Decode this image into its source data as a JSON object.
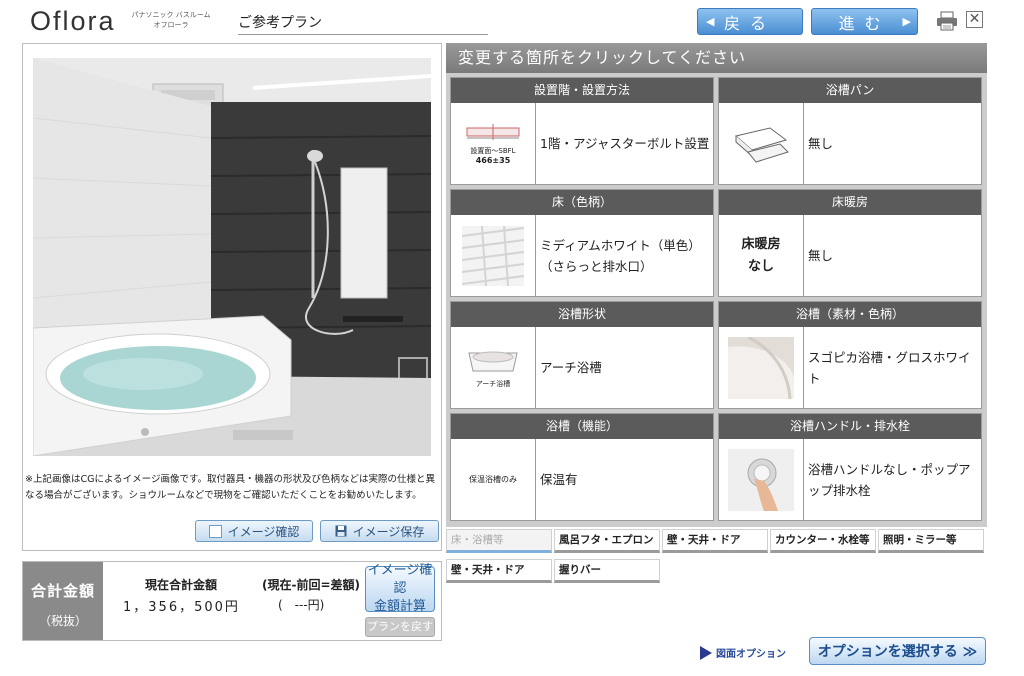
{
  "header": {
    "logo": "Oflora",
    "brand_line1": "パナソニック バスルーム",
    "brand_line2": "オフローラ",
    "plan_name": "ご参考プラン",
    "back_label": "戻る",
    "forward_label": "進む",
    "back_icon": "triangle-left-icon",
    "forward_icon": "triangle-right-icon",
    "close_glyph": "✕"
  },
  "preview": {
    "disclaimer": "※上記画像はCGによるイメージ画像です。取付器具・機器の形状及び色柄などは実際の仕様と異なる場合がございます。ショウルームなどで現物をご確認いただくことをお勧めいたします。",
    "confirm_label": "イメージ確認",
    "save_label": "イメージ保存"
  },
  "price": {
    "label": "合計金額",
    "tax_note": "（税抜）",
    "current_heading": "現在合計金額",
    "diff_heading": "(現在-前回=差額)",
    "current_value": "1，356，500円",
    "diff_value": "(　---円)",
    "calc_label_1": "イメージ確認",
    "calc_label_2": "金額計算",
    "restore_label": "プランを戻す"
  },
  "options": {
    "heading": "変更する箇所をクリックしてください",
    "cells": [
      {
        "title": "設置階・設置方法",
        "value": "1階・アジャスターボルト設置",
        "thumb_text_1": "設置面～SBFL",
        "thumb_text_2": "466±35"
      },
      {
        "title": "浴槽パン",
        "value": "無し"
      },
      {
        "title": "床（色柄）",
        "value": "ミディアムホワイト（単色）（さらっと排水口）"
      },
      {
        "title": "床暖房",
        "value": "無し",
        "thumb_text_1": "床暖房",
        "thumb_text_2": "なし"
      },
      {
        "title": "浴槽形状",
        "value": "アーチ浴槽",
        "thumb_text_1": "アーチ浴槽"
      },
      {
        "title": "浴槽（素材・色柄）",
        "value": "スゴピカ浴槽・グロスホワイト"
      },
      {
        "title": "浴槽（機能）",
        "value": "保温有",
        "thumb_text_1": "保温浴槽のみ"
      },
      {
        "title": "浴槽ハンドル・排水栓",
        "value": "浴槽ハンドルなし・ポップアップ排水栓"
      }
    ]
  },
  "tabs": [
    {
      "label": "床・浴槽等",
      "active": true
    },
    {
      "label": "風呂フタ・エプロン",
      "active": false
    },
    {
      "label": "壁・天井・ドア",
      "active": false
    },
    {
      "label": "カウンター・水栓等",
      "active": false
    },
    {
      "label": "照明・ミラー等",
      "active": false
    },
    {
      "label": "壁・天井・ドア",
      "active": false
    },
    {
      "label": "握りバー",
      "active": false
    }
  ],
  "footer": {
    "drawing_option": "図面オプション",
    "select_option": "オプションを選択する ≫"
  }
}
